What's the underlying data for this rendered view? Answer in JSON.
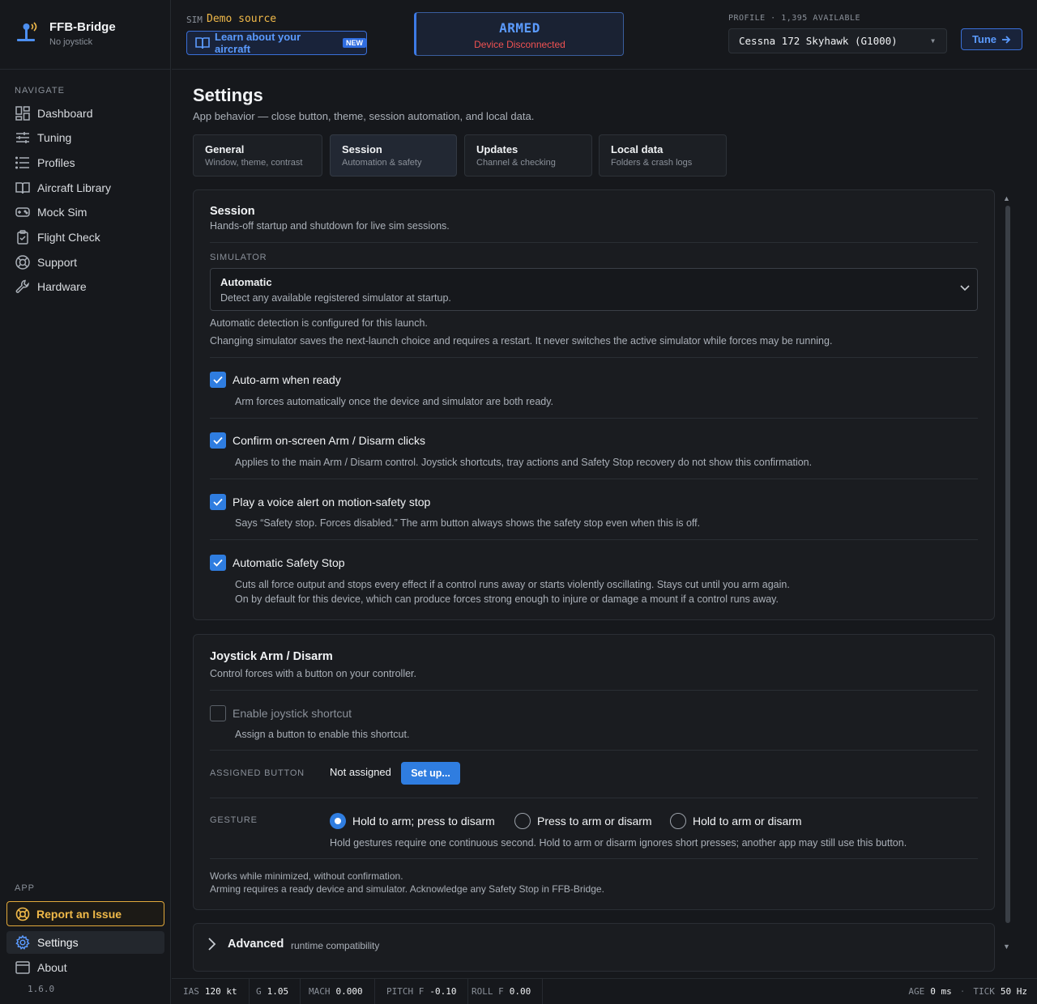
{
  "app": {
    "name": "FFB-Bridge",
    "subtitle": "No joystick",
    "version": "1.6.0"
  },
  "nav": {
    "heading": "NAVIGATE",
    "items": [
      {
        "label": "Dashboard",
        "icon": "dashboard-icon"
      },
      {
        "label": "Tuning",
        "icon": "sliders-icon"
      },
      {
        "label": "Profiles",
        "icon": "list-icon"
      },
      {
        "label": "Aircraft Library",
        "icon": "book-icon"
      },
      {
        "label": "Mock Sim",
        "icon": "gamepad-icon"
      },
      {
        "label": "Flight Check",
        "icon": "clipboard-check-icon"
      },
      {
        "label": "Support",
        "icon": "lifebuoy-icon"
      },
      {
        "label": "Hardware",
        "icon": "wrench-icon"
      }
    ],
    "app_heading": "APP",
    "report": "Report an Issue",
    "settings": "Settings",
    "about": "About"
  },
  "topbar": {
    "sim_label": "SIM",
    "sim_value": "Demo source",
    "learn_label": "Learn about your aircraft",
    "new_badge": "NEW",
    "arm_title": "ARMED",
    "arm_status": "Device Disconnected",
    "profile_label": "PROFILE · 1,395 AVAILABLE",
    "profile_value": "Cessna 172 Skyhawk (G1000)",
    "tune_label": "Tune"
  },
  "page": {
    "title": "Settings",
    "subtitle": "App behavior — close button, theme, session automation, and local data.",
    "tabs": [
      {
        "title": "General",
        "sub": "Window, theme, contrast"
      },
      {
        "title": "Session",
        "sub": "Automation & safety"
      },
      {
        "title": "Updates",
        "sub": "Channel & checking"
      },
      {
        "title": "Local data",
        "sub": "Folders & crash logs"
      }
    ]
  },
  "session": {
    "title": "Session",
    "subtitle": "Hands-off startup and shutdown for live sim sessions.",
    "simulator_label": "SIMULATOR",
    "simulator_value": "Automatic",
    "simulator_desc": "Detect any available registered simulator at startup.",
    "note1": "Automatic detection is configured for this launch.",
    "note2": "Changing simulator saves the next-launch choice and requires a restart. It never switches the active simulator while forces may be running.",
    "options": [
      {
        "label": "Auto-arm when ready",
        "desc": "Arm forces automatically once the device and simulator are both ready.",
        "checked": true
      },
      {
        "label": "Confirm on-screen Arm / Disarm clicks",
        "desc": "Applies to the main Arm / Disarm control. Joystick shortcuts, tray actions and Safety Stop recovery do not show this confirmation.",
        "checked": true
      },
      {
        "label": "Play a voice alert on motion-safety stop",
        "desc": "Says “Safety stop. Forces disabled.” The arm button always shows the safety stop even when this is off.",
        "checked": true
      },
      {
        "label": "Automatic Safety Stop",
        "desc": "Cuts all force output and stops every effect if a control runs away or starts violently oscillating. Stays cut until you arm again.",
        "desc2": "On by default for this device, which can produce forces strong enough to injure or damage a mount if a control runs away.",
        "checked": true
      }
    ]
  },
  "joystick": {
    "title": "Joystick Arm / Disarm",
    "subtitle": "Control forces with a button on your controller.",
    "enable_label": "Enable joystick shortcut",
    "enable_desc": "Assign a button to enable this shortcut.",
    "enable_checked": false,
    "assigned_label": "ASSIGNED BUTTON",
    "assigned_value": "Not assigned",
    "setup_label": "Set up...",
    "gesture_label": "GESTURE",
    "gestures": [
      "Hold to arm; press to disarm",
      "Press to arm or disarm",
      "Hold to arm or disarm"
    ],
    "gesture_selected": 0,
    "gesture_help": "Hold gestures require one continuous second. Hold to arm or disarm ignores short presses; another app may still use this button.",
    "footer1": "Works while minimized, without confirmation.",
    "footer2": "Arming requires a ready device and simulator. Acknowledge any Safety Stop in FFB-Bridge."
  },
  "advanced": {
    "title": "Advanced",
    "subtitle": "runtime compatibility"
  },
  "status": {
    "ias_k": "IAS",
    "ias_v": "120 kt",
    "g_k": "G",
    "g_v": "1.05",
    "mach_k": "MACH",
    "mach_v": "0.000",
    "pitch_k": "PITCH F",
    "pitch_v": "-0.10",
    "roll_k": "ROLL F",
    "roll_v": "0.00",
    "age_k": "AGE",
    "age_v": "0 ms",
    "tick_k": "TICK",
    "tick_v": "50 Hz"
  },
  "colors": {
    "accent": "#2f7de0",
    "warning": "#f0b949",
    "danger": "#f05252",
    "background": "#16181c"
  }
}
